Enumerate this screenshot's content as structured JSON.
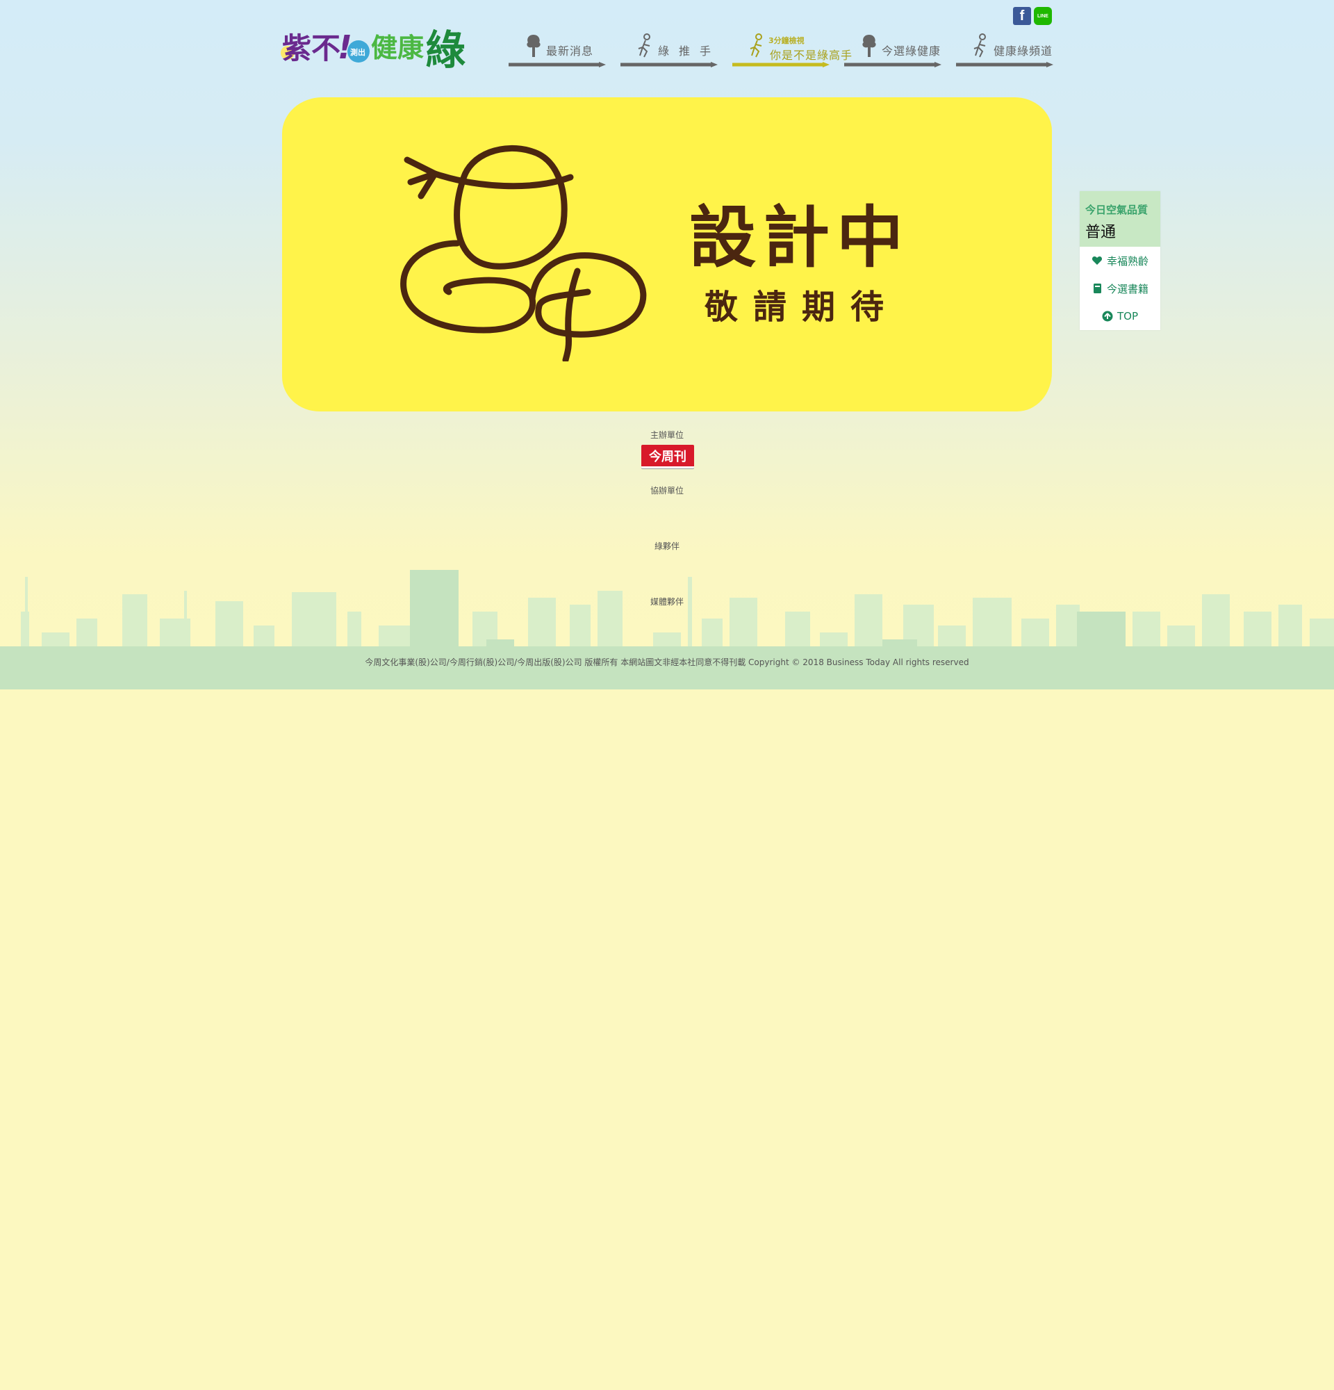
{
  "header": {
    "logo_text": "紫不!測出健康綠",
    "social": [
      {
        "name": "facebook",
        "icon": "facebook-icon",
        "glyph": "f"
      },
      {
        "name": "line",
        "icon": "line-icon",
        "glyph": "LINE"
      }
    ],
    "nav": [
      {
        "label": "最新消息",
        "sub": "",
        "icon": "tree-icon"
      },
      {
        "label": "綠推手",
        "sub": "",
        "icon": "runner-icon"
      },
      {
        "label": "你是不是綠高手",
        "sub": "3分鐘檢視",
        "icon": "runner-icon",
        "active": true
      },
      {
        "label": "今選綠健康",
        "sub": "",
        "icon": "tree-icon"
      },
      {
        "label": "健康綠頻道",
        "sub": "",
        "icon": "runner-icon"
      }
    ],
    "colors": {
      "nav_text": "#666666",
      "nav_active": "#a9a11c"
    }
  },
  "banner": {
    "title": "設計中",
    "subtitle": "敬請期待",
    "background": "#fff34a",
    "text_color": "#4b2610"
  },
  "side_panel": {
    "air_label": "今日空氣品質",
    "air_value": "普通",
    "links": [
      {
        "label": "幸福熟齡",
        "icon": "heart-icon"
      },
      {
        "label": "今選書籍",
        "icon": "book-icon"
      },
      {
        "label": "TOP",
        "icon": "arrow-up-icon"
      }
    ]
  },
  "footer": {
    "organizer_label": "主辦單位",
    "organizer_logo_text": "今周刊",
    "co_organizer_label": "協辦單位",
    "partner_label": "綠夥伴",
    "media_partner_label": "媒體夥伴",
    "copyright": "今周文化事業(股)公司/今周行銷(股)公司/今周出版(股)公司 版權所有 本網站圖文非經本社同意不得刊載 Copyright © 2018 Business Today All rights reserved"
  }
}
